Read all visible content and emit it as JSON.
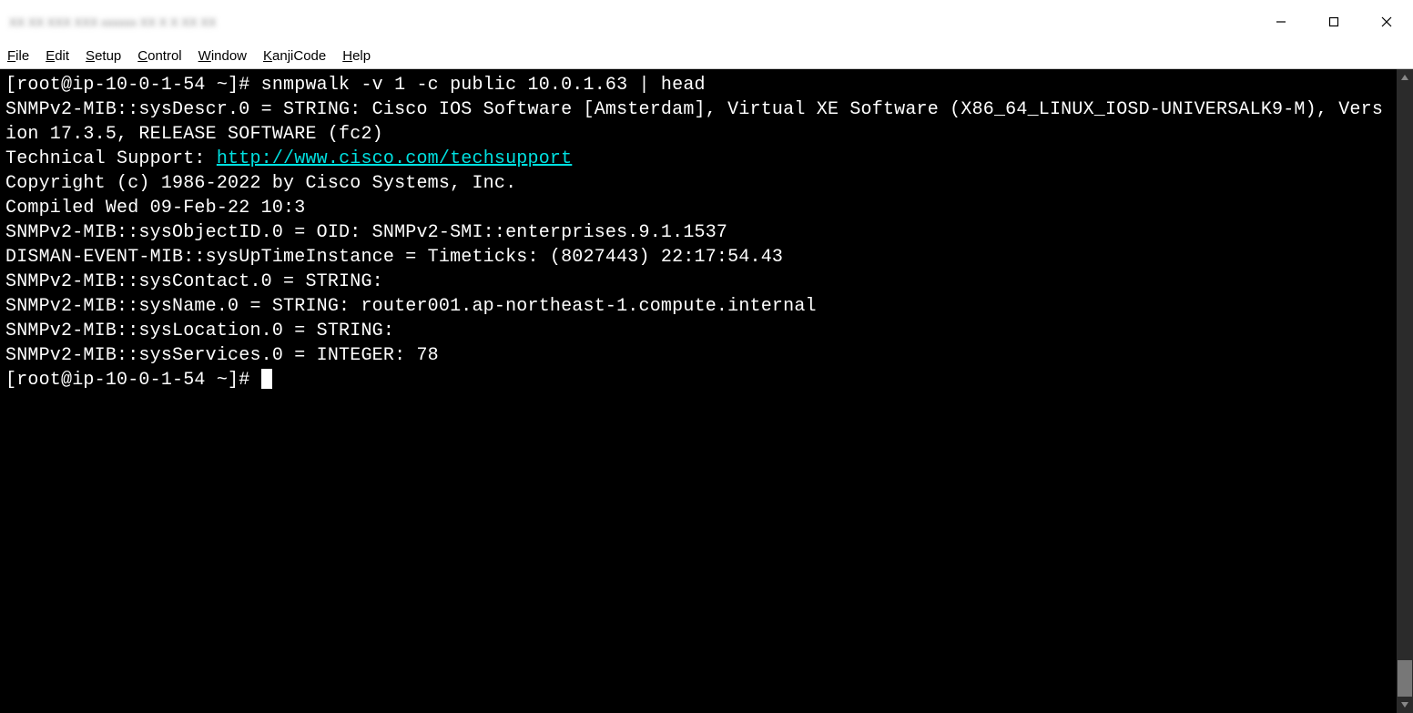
{
  "titlebar": {
    "title_blurred": "XX XX XXX XXX  xxxxxx XX X X XX  XX"
  },
  "menubar": {
    "file": "File",
    "edit": "Edit",
    "setup": "Setup",
    "control": "Control",
    "window": "Window",
    "kanjicode": "KanjiCode",
    "help": "Help"
  },
  "terminal": {
    "lines": [
      "[root@ip-10-0-1-54 ~]# snmpwalk -v 1 -c public 10.0.1.63 | head",
      "SNMPv2-MIB::sysDescr.0 = STRING: Cisco IOS Software [Amsterdam], Virtual XE Software (X86_64_LINUX_IOSD-UNIVERSALK9-M), Version 17.3.5, RELEASE SOFTWARE (fc2)"
    ],
    "support_prefix": "Technical Support: ",
    "support_link": "http://www.cisco.com/techsupport",
    "lines2": [
      "Copyright (c) 1986-2022 by Cisco Systems, Inc.",
      "Compiled Wed 09-Feb-22 10:3",
      "SNMPv2-MIB::sysObjectID.0 = OID: SNMPv2-SMI::enterprises.9.1.1537",
      "DISMAN-EVENT-MIB::sysUpTimeInstance = Timeticks: (8027443) 22:17:54.43",
      "SNMPv2-MIB::sysContact.0 = STRING:",
      "SNMPv2-MIB::sysName.0 = STRING: router001.ap-northeast-1.compute.internal",
      "SNMPv2-MIB::sysLocation.0 = STRING:",
      "SNMPv2-MIB::sysServices.0 = INTEGER: 78"
    ],
    "prompt2": "[root@ip-10-0-1-54 ~]# "
  }
}
